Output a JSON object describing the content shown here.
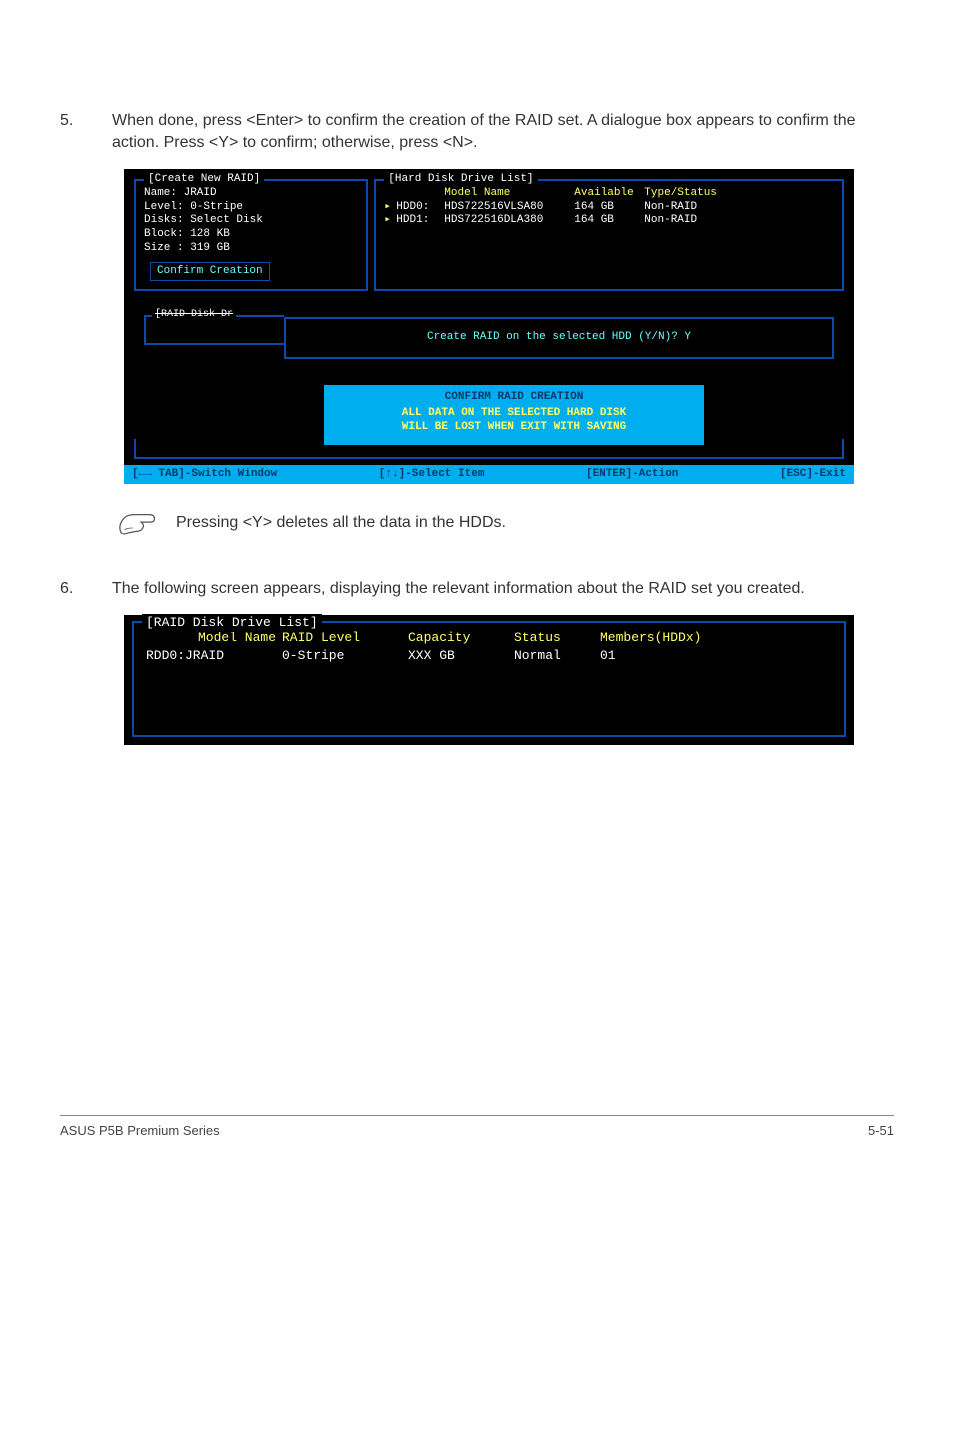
{
  "step5": {
    "num": "5.",
    "text": "When done, press <Enter> to confirm the creation of the RAID set. A dialogue box appears to confirm the action. Press <Y> to confirm; otherwise, press <N>."
  },
  "create_panel": {
    "title": "[Create New RAID]",
    "lines": {
      "name": "Name: JRAID",
      "level": "Level: 0-Stripe",
      "disks": "Disks: Select Disk",
      "block": "Block: 128 KB",
      "size": "Size : 319 GB"
    },
    "confirm_btn": "Confirm Creation"
  },
  "hdd_panel": {
    "title": "[Hard Disk Drive List]",
    "head": {
      "model": "Model Name",
      "avail": "Available",
      "type": "Type/Status"
    },
    "rows": [
      {
        "idx": "HDD0:",
        "name": "HDS722516VLSA80",
        "avail": "164 GB",
        "type": "Non-RAID"
      },
      {
        "idx": "HDD1:",
        "name": "HDS722516DLA380",
        "avail": "164 GB",
        "type": "Non-RAID"
      }
    ]
  },
  "raidlist_stub": "[RAID Disk Dr",
  "dialog": {
    "prompt": "Create RAID on the selected HDD (Y/N)? Y"
  },
  "confirm_box": {
    "line1": "CONFIRM RAID CREATION",
    "line2a": "ALL DATA ON THE SELECTED HARD DISK",
    "line2b": "WILL BE LOST WHEN EXIT WITH SAVING"
  },
  "keybar": {
    "tab": "[←→ TAB]-Switch Window",
    "sel": "[↑↓]-Select Item",
    "enter": "[ENTER]-Action",
    "esc": "[ESC]-Exit"
  },
  "note": "Pressing <Y> deletes all the data in the HDDs.",
  "step6": {
    "num": "6.",
    "text": "The following screen appears, displaying the relevant information about the RAID set you created."
  },
  "panel2": {
    "title": "[RAID Disk Drive List]",
    "head": {
      "model": "Model Name",
      "level": "RAID Level",
      "cap": "Capacity",
      "stat": "Status",
      "memb": "Members(HDDx)"
    },
    "row": {
      "model": "RDD0:JRAID",
      "level": "0-Stripe",
      "cap": "XXX GB",
      "stat": "Normal",
      "memb": "01"
    }
  },
  "footer": {
    "left": "ASUS P5B Premium Series",
    "right": "5-51"
  }
}
